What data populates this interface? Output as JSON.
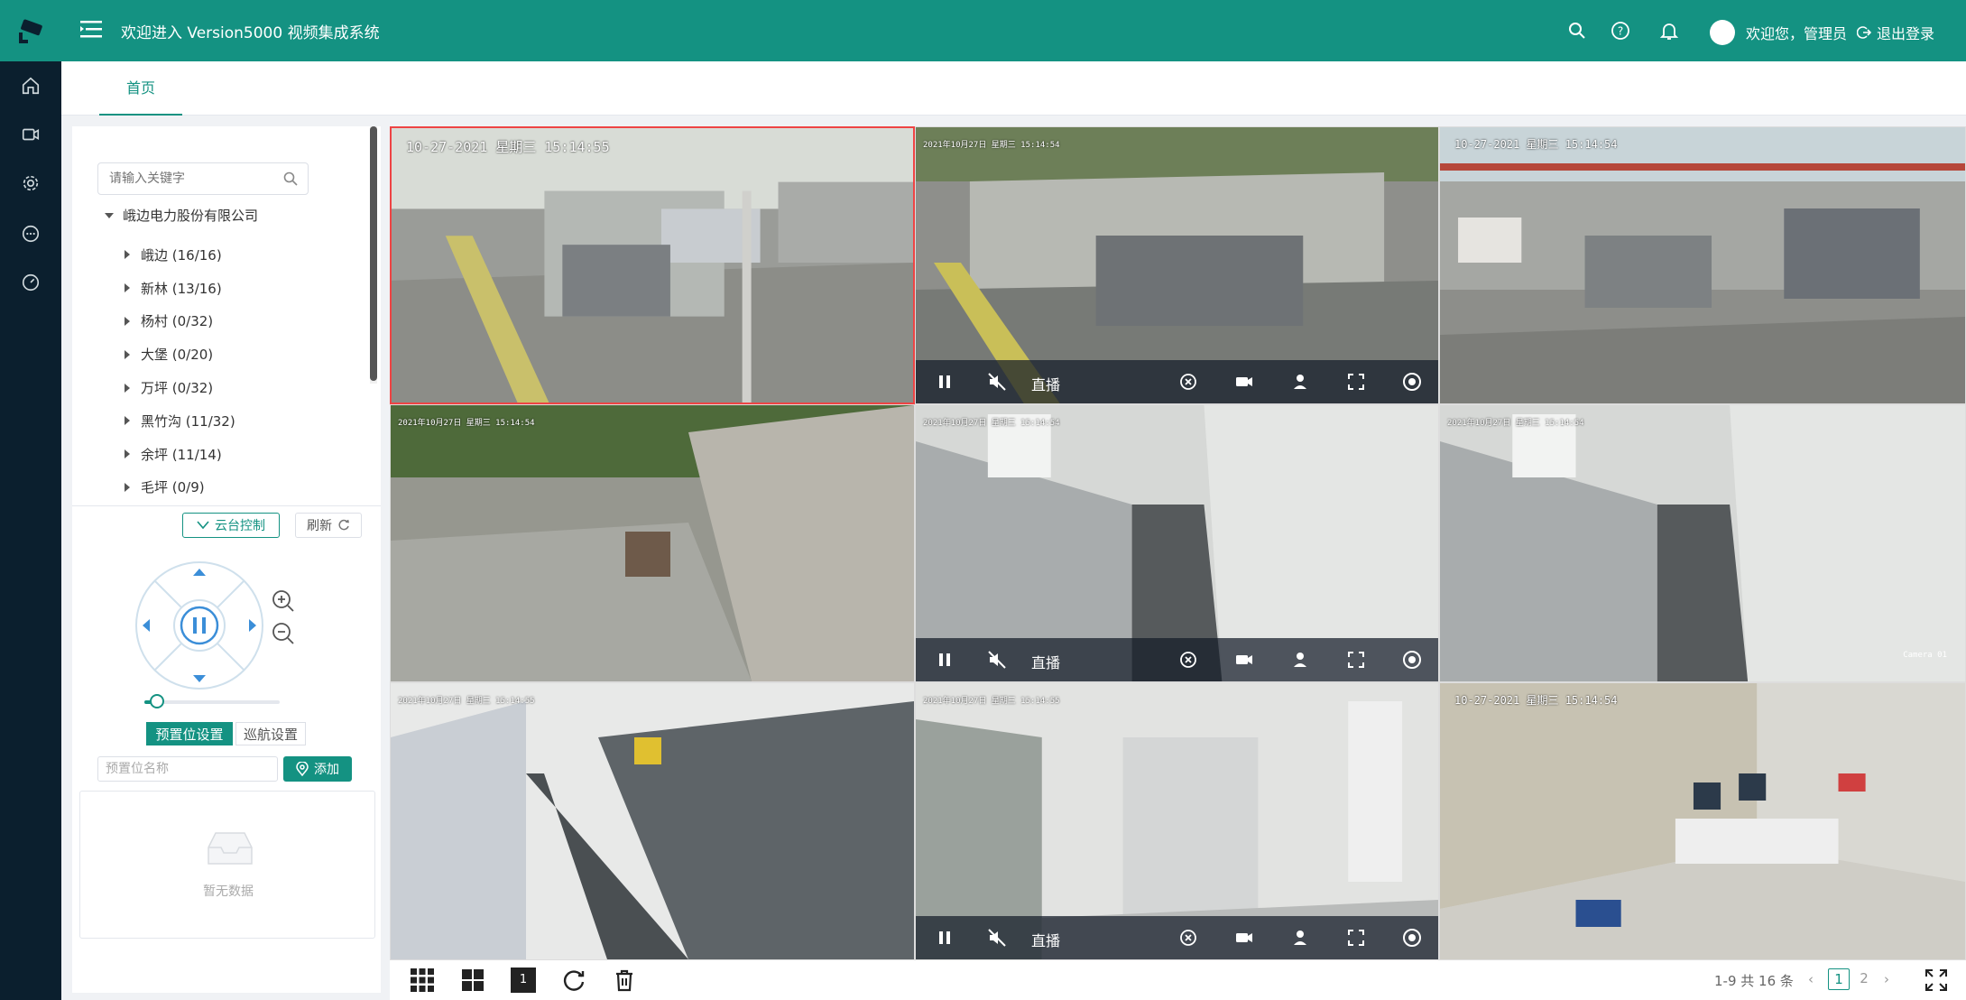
{
  "header": {
    "title": "欢迎进入 Version5000 视频集成系统",
    "welcome": "欢迎您，管理员",
    "logout": "退出登录"
  },
  "tabs": [
    {
      "label": "首页"
    }
  ],
  "sidebar": {
    "search_placeholder": "请输入关键字",
    "root": "峨边电力股份有限公司",
    "items": [
      {
        "label": "峨边 (16/16)"
      },
      {
        "label": "新林 (13/16)"
      },
      {
        "label": "杨村 (0/32)"
      },
      {
        "label": "大堡 (0/20)"
      },
      {
        "label": "万坪 (0/32)"
      },
      {
        "label": "黑竹沟 (11/32)"
      },
      {
        "label": "余坪 (11/14)"
      },
      {
        "label": "毛坪 (0/9)"
      }
    ]
  },
  "ptz": {
    "ptz_control": "云台控制",
    "refresh": "刷新",
    "speed_level": 0.05,
    "preset_tab": "预置位设置",
    "cruise_tab": "巡航设置",
    "preset_placeholder": "预置位名称",
    "add": "添加",
    "empty": "暂无数据"
  },
  "cells": [
    {
      "osd": "10-27-2021 星期三 15:14:55",
      "cam": ""
    },
    {
      "osd": "2021年10月27日 星期三 15:14:54",
      "cam": ""
    },
    {
      "osd": "10-27-2021 星期三 15:14:54",
      "cam": ""
    },
    {
      "osd": "2021年10月27日 星期三 15:14:54",
      "cam": ""
    },
    {
      "osd": "2021年10月27日 星期三 15:14:54",
      "cam": ""
    },
    {
      "osd": "2021年10月27日 星期三 15:14:54",
      "cam": "Camera 01"
    },
    {
      "osd": "2021年10月27日 星期三 15:14:55",
      "cam": ""
    },
    {
      "osd": "2021年10月27日 星期三 15:14:55",
      "cam": ""
    },
    {
      "osd": "10-27-2021 星期三 15:14:54",
      "cam": ""
    }
  ],
  "controls": {
    "live": "直播"
  },
  "pager": {
    "total": "1-9 共 16 条",
    "pages": [
      "1",
      "2"
    ],
    "current": "1",
    "layout_1": "1"
  },
  "colors": {
    "brand": "#149282",
    "rail": "#0b1f2e",
    "active_border": "#ee4444"
  }
}
